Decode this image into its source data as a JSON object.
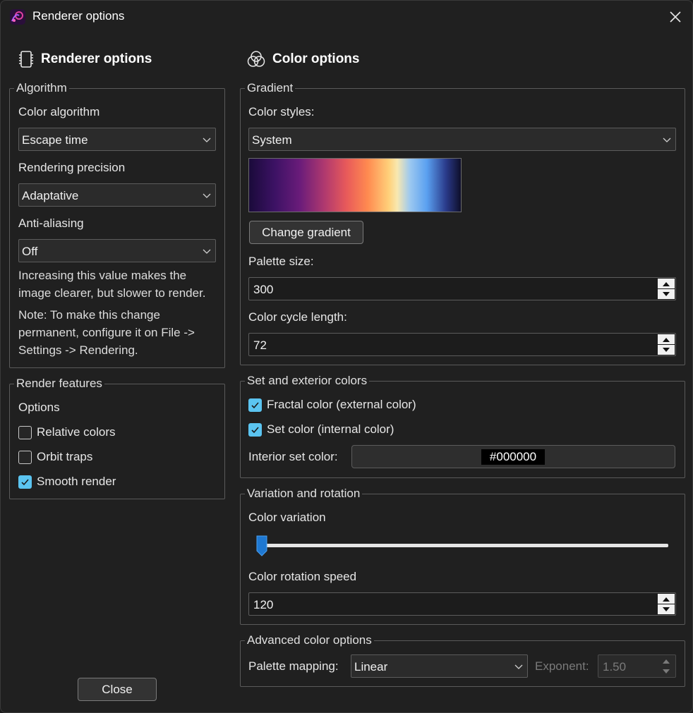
{
  "window": {
    "title": "Renderer options",
    "app_icon": "fractal-app-icon",
    "close_icon": "close-icon"
  },
  "renderer": {
    "heading": "Renderer options",
    "heading_icon": "chip-icon",
    "algorithm": {
      "legend": "Algorithm",
      "color_algorithm_label": "Color algorithm",
      "color_algorithm_value": "Escape time",
      "precision_label": "Rendering precision",
      "precision_value": "Adaptative",
      "antialias_label": "Anti-aliasing",
      "antialias_value": "Off",
      "hint": "Increasing this value makes the image clearer, but slower to render.",
      "note": "Note: To make this change permanent, configure it on File -> Settings -> Rendering."
    },
    "features": {
      "legend": "Render features",
      "options_label": "Options",
      "items": [
        {
          "label": "Relative colors",
          "checked": false
        },
        {
          "label": "Orbit traps",
          "checked": false
        },
        {
          "label": "Smooth render",
          "checked": true
        }
      ]
    },
    "close_button": "Close"
  },
  "color": {
    "heading": "Color options",
    "heading_icon": "color-circles-icon",
    "gradient": {
      "legend": "Gradient",
      "styles_label": "Color styles:",
      "styles_value": "System",
      "change_button": "Change gradient",
      "palette_size_label": "Palette size:",
      "palette_size_value": "300",
      "cycle_label": "Color cycle length:",
      "cycle_value": "72"
    },
    "set_colors": {
      "legend": "Set and exterior colors",
      "fractal_color_label": "Fractal color (external color)",
      "fractal_color_checked": true,
      "set_color_label": "Set color (internal color)",
      "set_color_checked": true,
      "interior_label": "Interior set color:",
      "interior_value": "#000000"
    },
    "variation": {
      "legend": "Variation and rotation",
      "variation_label": "Color variation",
      "variation_level": 0,
      "rotation_label": "Color rotation speed",
      "rotation_value": "120"
    },
    "advanced": {
      "legend": "Advanced color options",
      "mapping_label": "Palette mapping:",
      "mapping_value": "Linear",
      "exponent_label": "Exponent:",
      "exponent_value": "1.50"
    }
  },
  "colors": {
    "accent": "#5bc4f0",
    "slider_thumb": "#1e78d2",
    "background": "#202020"
  }
}
